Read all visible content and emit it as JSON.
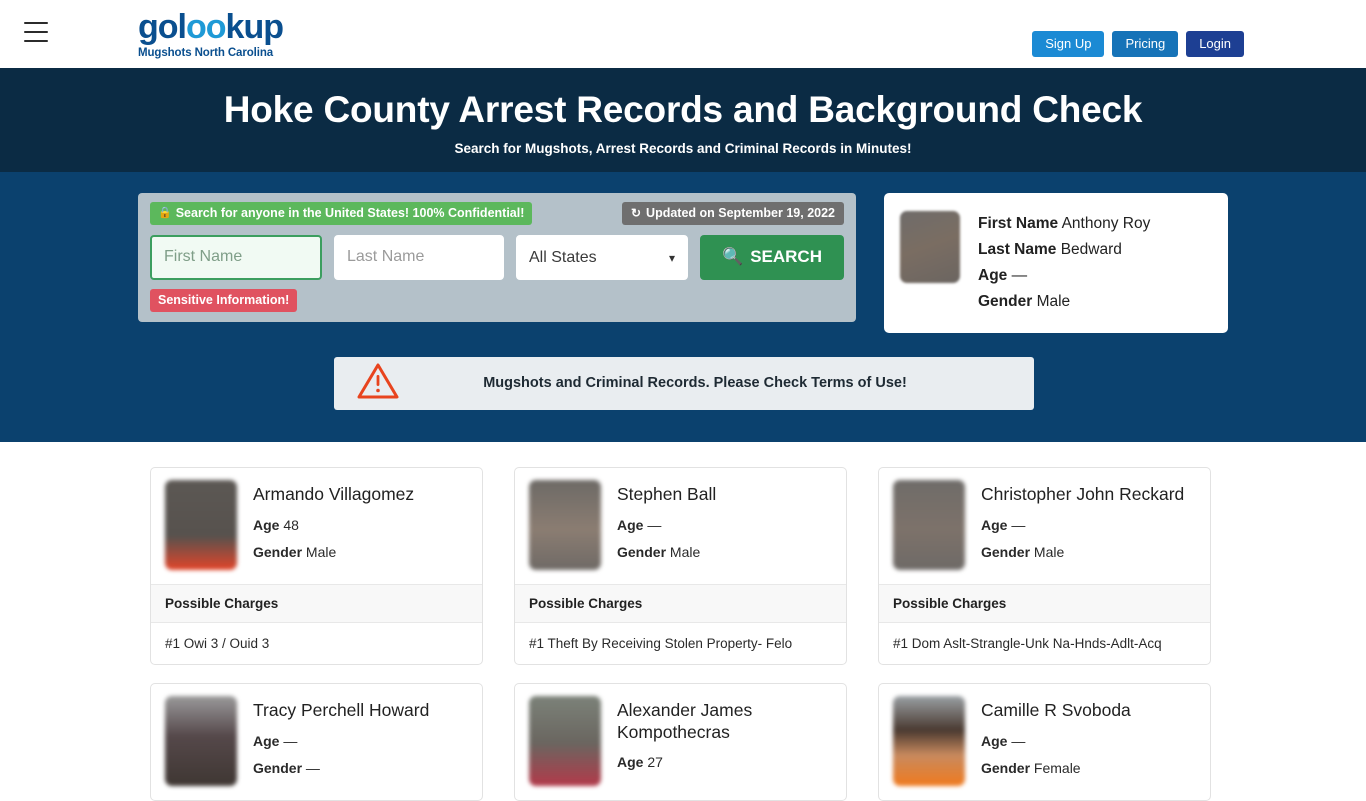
{
  "header": {
    "menu_icon": "hamburger-icon",
    "logo_text_1": "gol",
    "logo_text_oo": "oo",
    "logo_text_2": "kup",
    "logo_subtitle": "Mugshots North Carolina",
    "sign_up": "Sign Up",
    "pricing": "Pricing",
    "login": "Login",
    "colors": {
      "signup_bg": "#1b8ad4",
      "pricing_bg": "#1673b8",
      "login_bg": "#1d3f93",
      "logo_blue": "#1378bd"
    }
  },
  "hero": {
    "title": "Hoke County Arrest Records and Background Check",
    "subtitle": "Search for Mugshots, Arrest Records and Criminal Records in Minutes!",
    "band_bg": "#0b2b44",
    "search_band_bg": "#0b416e"
  },
  "search": {
    "confidential_badge": "Search for anyone in the United States! 100% Confidential!",
    "lock_icon": "lock-icon",
    "updated_badge": "Updated on September 19, 2022",
    "refresh_icon": "refresh-icon",
    "first_name_placeholder": "First Name",
    "first_name_value": "",
    "last_name_placeholder": "Last Name",
    "last_name_value": "",
    "state_selected": "All States",
    "state_options": [
      "All States"
    ],
    "search_button": "SEARCH",
    "search_icon": "search-icon",
    "sensitive_badge": "Sensitive Information!",
    "panel_bg": "#b4c1c9",
    "button_green": "#2f9152"
  },
  "featured": {
    "avatar": "mugshot-thumbnail",
    "first_name_label": "First Name",
    "first_name_value": "Anthony Roy",
    "last_name_label": "Last Name",
    "last_name_value": "Bedward",
    "age_label": "Age",
    "age_value": "—",
    "gender_label": "Gender",
    "gender_value": "Male"
  },
  "warning": {
    "icon": "warning-triangle-icon",
    "text": "Mugshots and Criminal Records. Please Check Terms of Use!",
    "bg": "#e9edf0",
    "icon_color": "#e8441e"
  },
  "results": {
    "age_label": "Age",
    "gender_label": "Gender",
    "charges_header": "Possible Charges",
    "cards": [
      {
        "name": "Armando Villagomez",
        "age": "48",
        "gender": "Male",
        "charge": "#1 Owi 3 / Ouid 3",
        "thumb_top": "#5c5854",
        "thumb_bottom": "#e2452a"
      },
      {
        "name": "Stephen Ball",
        "age": "—",
        "gender": "Male",
        "charge": "#1 Theft By Receiving Stolen Property- Felo",
        "thumb_top": "#6d6a66",
        "thumb_bottom": "#8b7d72"
      },
      {
        "name": "Christopher John Reckard",
        "age": "—",
        "gender": "Male",
        "charge": "#1 Dom Aslt-Strangle-Unk Na-Hnds-Adlt-Acq",
        "thumb_top": "#6f6c69",
        "thumb_bottom": "#7d726a"
      },
      {
        "name": "Tracy Perchell Howard",
        "age": "—",
        "gender": "—",
        "charge": "",
        "thumb_top": "#8b8b8b",
        "thumb_bottom": "#4a403c"
      },
      {
        "name": "Alexander James Kompothecras",
        "age": "27",
        "gender": "",
        "charge": "",
        "thumb_top": "#7c8279",
        "thumb_bottom": "#b23a4a"
      },
      {
        "name": "Camille R Svoboda",
        "age": "—",
        "gender": "Female",
        "charge": "",
        "thumb_top": "#9aa0a4",
        "thumb_bottom": "#f07a1e"
      }
    ]
  }
}
